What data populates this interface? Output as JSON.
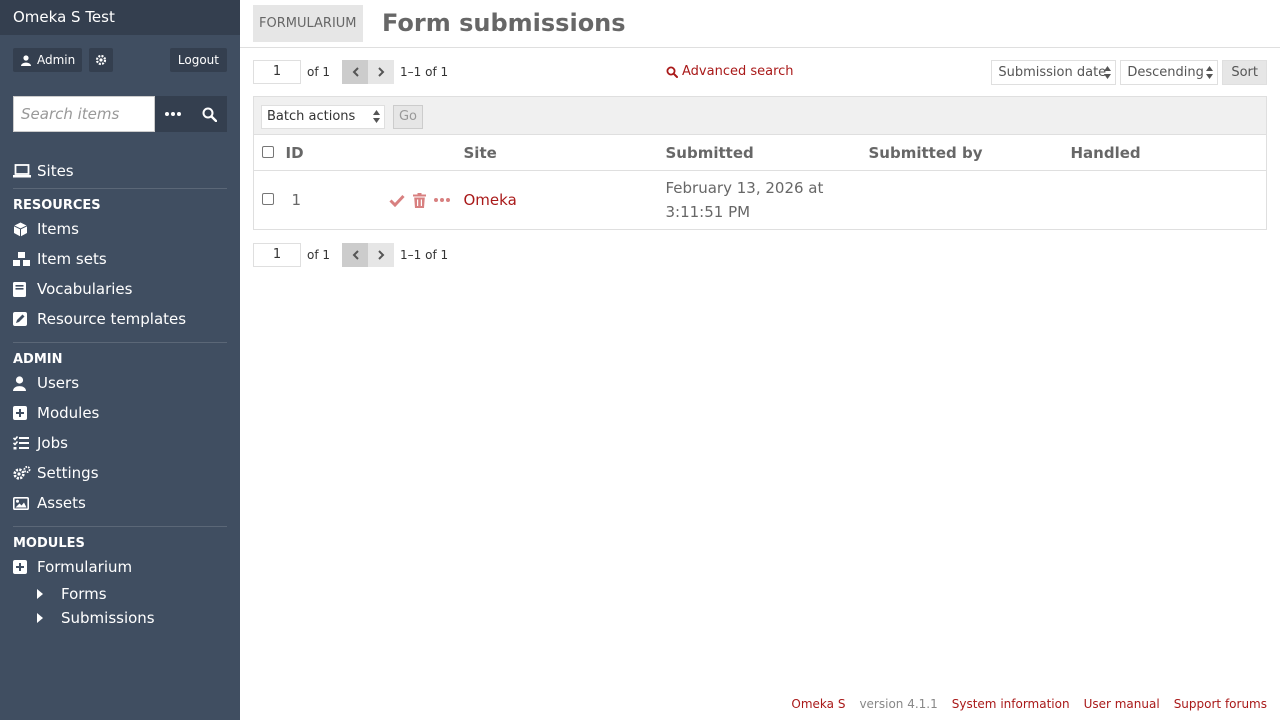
{
  "sidebar": {
    "site_title": "Omeka S Test",
    "user_label": "Admin",
    "logout_label": "Logout",
    "search_placeholder": "Search items",
    "sites_label": "Sites",
    "resources_heading": "Resources",
    "resources": [
      "Items",
      "Item sets",
      "Vocabularies",
      "Resource templates"
    ],
    "admin_heading": "Admin",
    "admin": [
      "Users",
      "Modules",
      "Jobs",
      "Settings",
      "Assets"
    ],
    "modules_heading": "Modules",
    "module_name": "Formularium",
    "module_items": [
      "Forms",
      "Submissions"
    ]
  },
  "header": {
    "module_badge": "FORMULARIUM",
    "title": "Form submissions"
  },
  "pagination": {
    "page": "1",
    "of": "of 1",
    "range": "1–1 of 1"
  },
  "advanced_search": "Advanced search",
  "sort": {
    "by": "Submission date",
    "order": "Descending",
    "button": "Sort"
  },
  "batch": {
    "select": "Batch actions",
    "go": "Go"
  },
  "table": {
    "columns": [
      "ID",
      "Site",
      "Submitted",
      "Submitted by",
      "Handled"
    ],
    "rows": [
      {
        "id": "1",
        "site": "Omeka",
        "submitted_line1": "February 13, 2026 at",
        "submitted_line2": "3:11:51 PM",
        "submitted_by": "",
        "handled": ""
      }
    ]
  },
  "footer": {
    "brand": "Omeka S",
    "version": "version 4.1.1",
    "system_info": "System information",
    "manual": "User manual",
    "forums": "Support forums"
  },
  "colors": {
    "sidebar_bg": "#404e61",
    "accent": "#a91919"
  }
}
